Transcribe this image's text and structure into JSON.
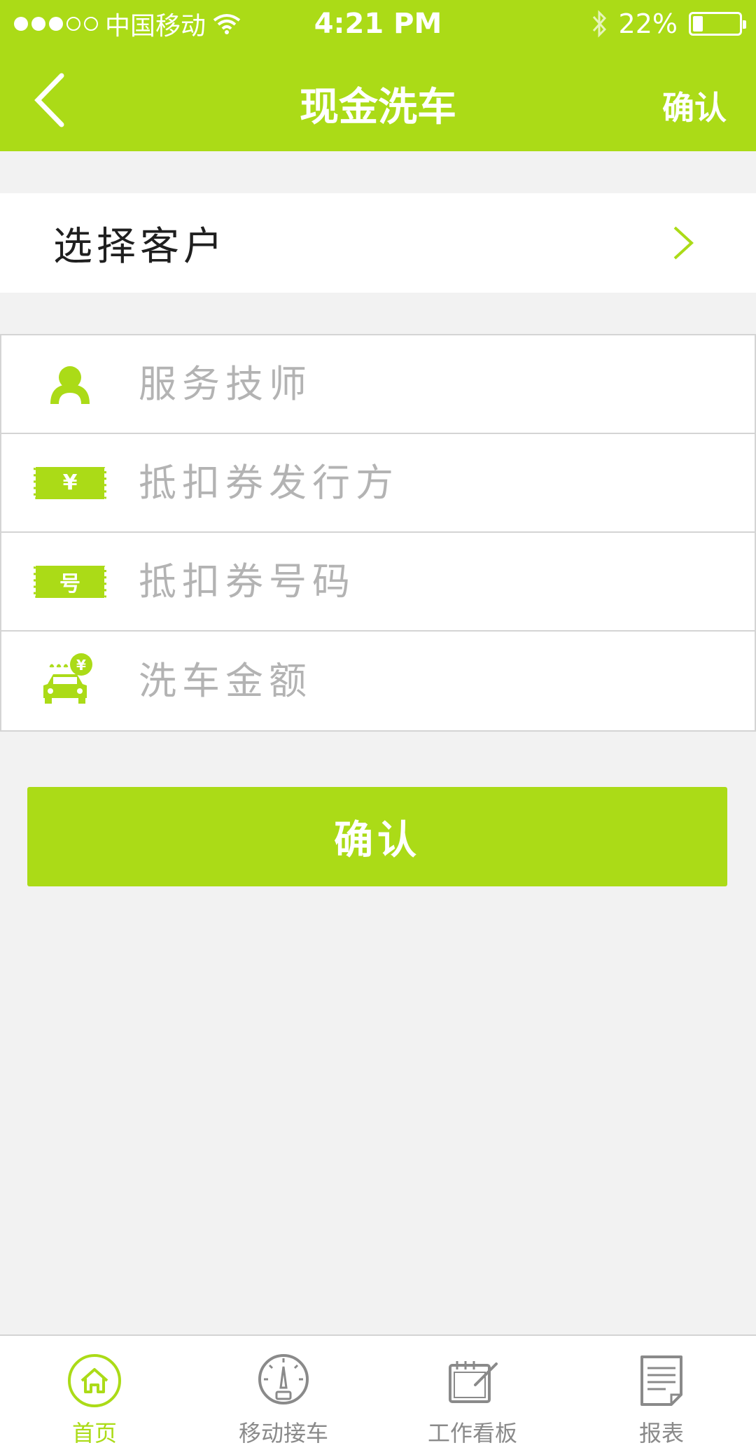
{
  "status_bar": {
    "carrier": "中国移动",
    "time": "4:21 PM",
    "battery": "22%",
    "battery_level": 0.22,
    "signal_dots": [
      "filled",
      "filled",
      "filled",
      "empty",
      "empty"
    ]
  },
  "nav": {
    "title": "现金洗车",
    "confirm": "确认",
    "back_icon": "chevron-left-icon"
  },
  "select_customer": {
    "label": "选择客户",
    "icon": "chevron-right-icon"
  },
  "form": {
    "fields": [
      {
        "placeholder": "服务技师",
        "value": "",
        "icon": "person-icon"
      },
      {
        "placeholder": "抵扣券发行方",
        "value": "",
        "icon": "voucher-yuan-icon",
        "icon_text": "¥"
      },
      {
        "placeholder": "抵扣券号码",
        "value": "",
        "icon": "voucher-number-icon",
        "icon_text": "号"
      },
      {
        "placeholder": "洗车金额",
        "value": "",
        "icon": "car-wash-yuan-icon"
      }
    ]
  },
  "confirm_button": {
    "label": "确认"
  },
  "tab_bar": {
    "tabs": [
      {
        "label": "首页",
        "icon": "home-icon",
        "active": true
      },
      {
        "label": "移动接车",
        "icon": "gauge-icon",
        "active": false
      },
      {
        "label": "工作看板",
        "icon": "board-icon",
        "active": false
      },
      {
        "label": "报表",
        "icon": "report-icon",
        "active": false
      }
    ]
  },
  "colors": {
    "accent": "#abdb17",
    "background": "#f2f2f2",
    "placeholder": "#b3b3b3",
    "tab_inactive": "#8a8a8a"
  }
}
